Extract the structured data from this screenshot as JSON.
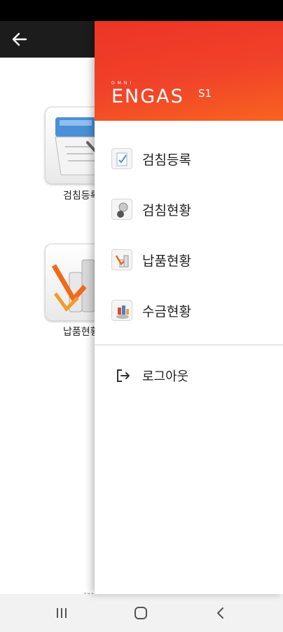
{
  "app_bar": {
    "back_icon": "arrow-left-icon"
  },
  "tiles": [
    {
      "label": "검침등록",
      "icon": "meter-device-icon"
    },
    {
      "label": "납품현황",
      "icon": "delivery-chart-icon"
    }
  ],
  "drawer": {
    "logo": {
      "omni": "OMNI",
      "main": "ENGAS",
      "sub": "S1"
    },
    "menu": [
      {
        "label": "검침등록",
        "icon": "meter-register-icon"
      },
      {
        "label": "검침현황",
        "icon": "meter-status-icon"
      },
      {
        "label": "납품현황",
        "icon": "delivery-status-icon"
      },
      {
        "label": "수금현황",
        "icon": "collection-status-icon"
      }
    ],
    "logout": {
      "label": "로그아웃",
      "icon": "logout-icon"
    }
  },
  "bottom_logo": {
    "text": "OMNI"
  },
  "nav_bar": {
    "recents_icon": "recents-icon",
    "home_icon": "home-icon",
    "back_icon": "back-icon"
  },
  "colors": {
    "brand_red": "#ef3b2a",
    "brand_orange": "#f8641f",
    "app_bar": "#1c1c1c"
  }
}
